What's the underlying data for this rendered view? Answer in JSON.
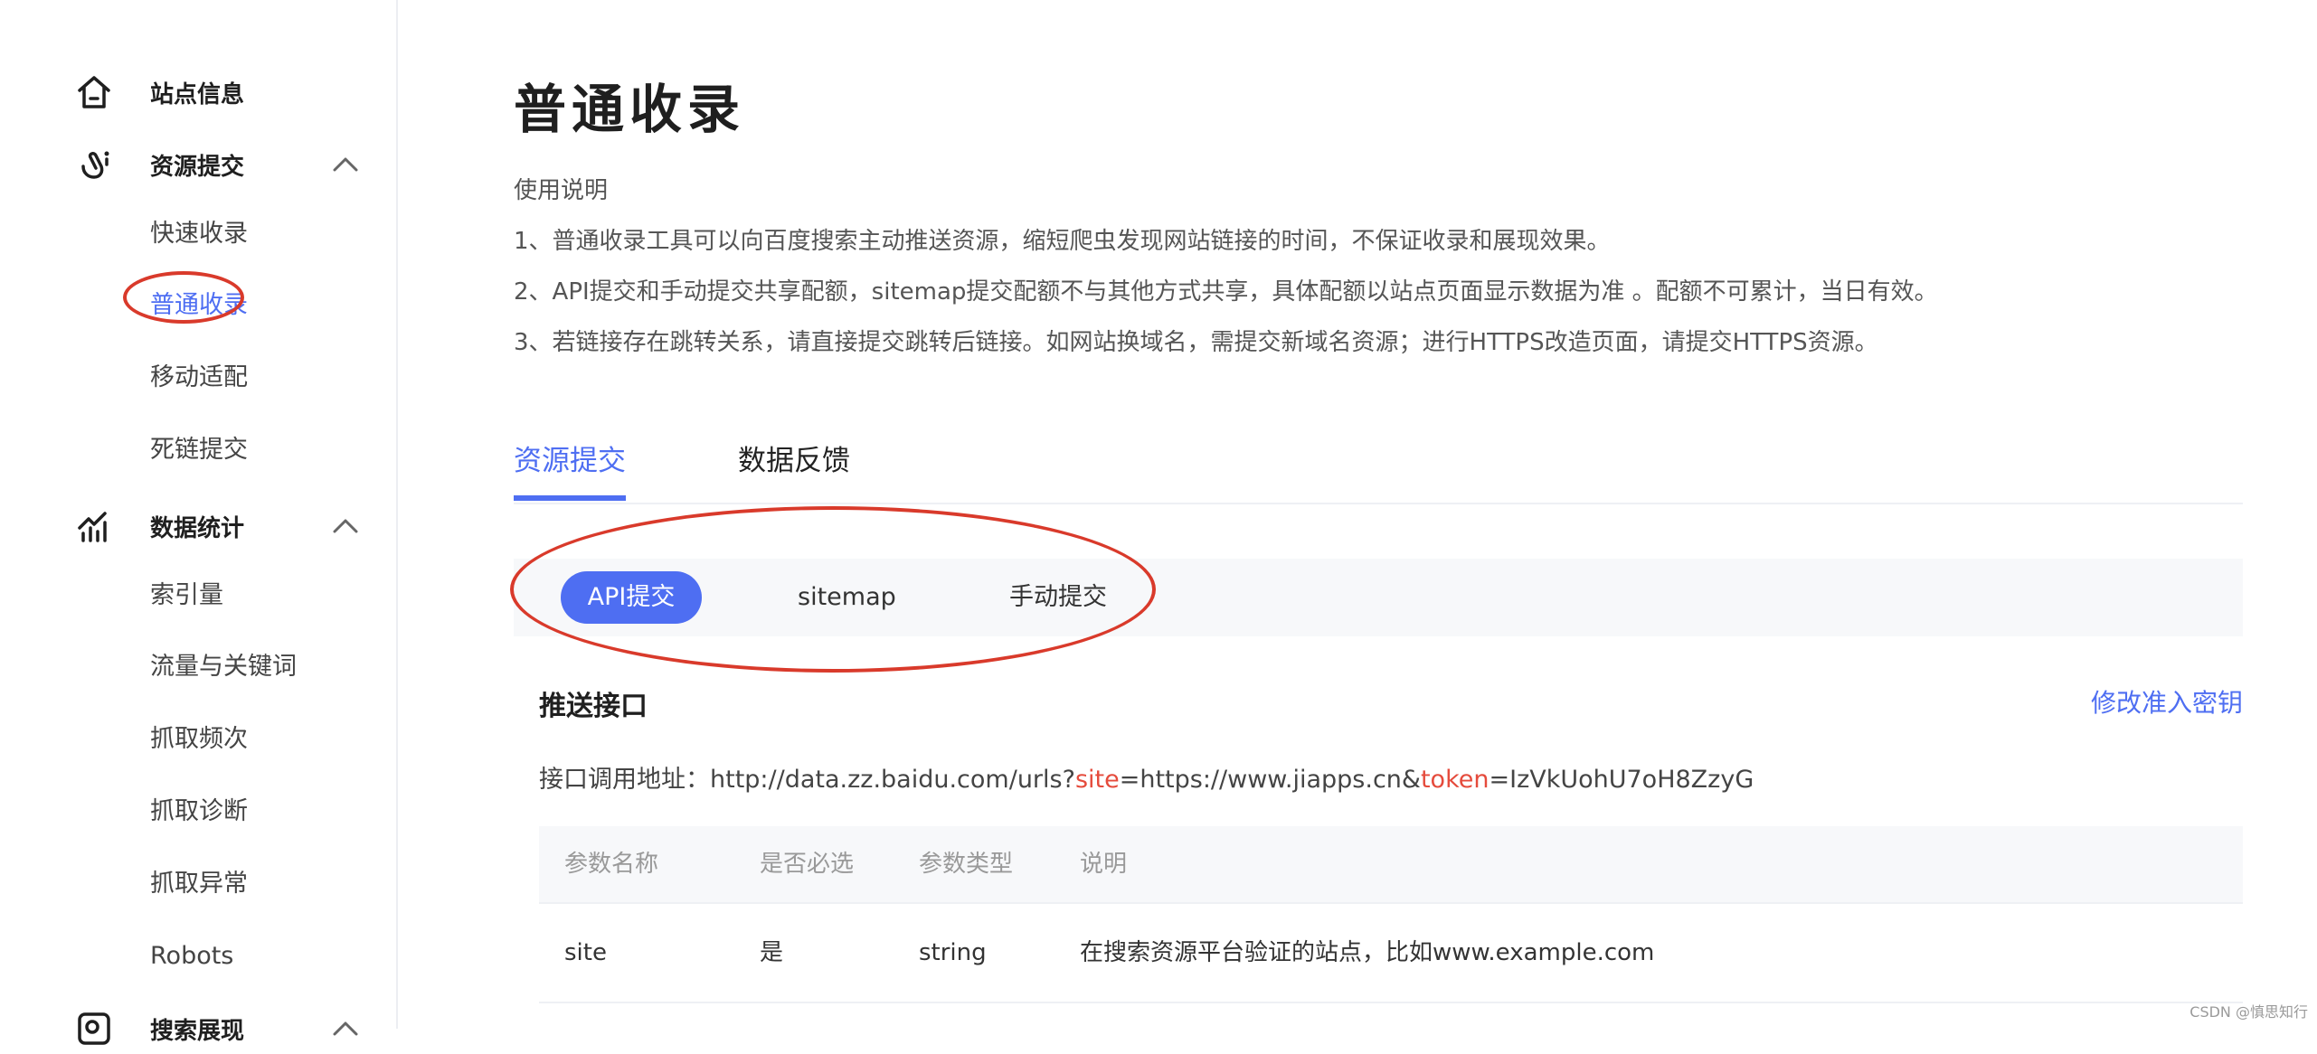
{
  "sidebar": {
    "groups": [
      {
        "label": "站点信息",
        "icon": "home-icon"
      },
      {
        "label": "资源提交",
        "icon": "resource-submit-icon",
        "expanded": true,
        "items": [
          "快速收录",
          "普通收录",
          "移动适配",
          "死链提交"
        ]
      },
      {
        "label": "数据统计",
        "icon": "stats-icon",
        "expanded": true,
        "items": [
          "索引量",
          "流量与关键词",
          "抓取频次",
          "抓取诊断",
          "抓取异常",
          "Robots"
        ]
      },
      {
        "label": "搜索展现",
        "icon": "search-display-icon",
        "expanded": true
      }
    ],
    "active_item": "普通收录"
  },
  "main": {
    "title": "普通收录",
    "intro_heading": "使用说明",
    "intro_lines": [
      "1、普通收录工具可以向百度搜索主动推送资源，缩短爬虫发现网站链接的时间，不保证收录和展现效果。",
      "2、API提交和手动提交共享配额，sitemap提交配额不与其他方式共享，具体配额以站点页面显示数据为准 。配额不可累计，当日有效。",
      "3、若链接存在跳转关系，请直接提交跳转后链接。如网站换域名，需提交新域名资源；进行HTTPS改造页面，请提交HTTPS资源。"
    ],
    "tabs": [
      {
        "label": "资源提交",
        "active": true
      },
      {
        "label": "数据反馈",
        "active": false
      }
    ],
    "subtabs": [
      {
        "label": "API提交",
        "active": true
      },
      {
        "label": "sitemap",
        "active": false
      },
      {
        "label": "手动提交",
        "active": false
      }
    ],
    "section_title": "推送接口",
    "modify_link": "修改准入密钥",
    "endpoint": {
      "prefix": "接口调用地址：http://data.zz.baidu.com/urls?",
      "param1": "site",
      "value1": "=https://www.jiapps.cn&",
      "param2": "token",
      "value2": "=IzVkUohU7oH8ZzyG"
    },
    "table": {
      "headers": [
        "参数名称",
        "是否必选",
        "参数类型",
        "说明"
      ],
      "rows": [
        [
          "site",
          "是",
          "string",
          "在搜索资源平台验证的站点，比如www.example.com"
        ]
      ]
    }
  },
  "watermark": "CSDN @慎思知行",
  "colors": {
    "accent": "#4e6ef2",
    "annotation": "#d93a2b",
    "highlight": "#e54b3c"
  }
}
